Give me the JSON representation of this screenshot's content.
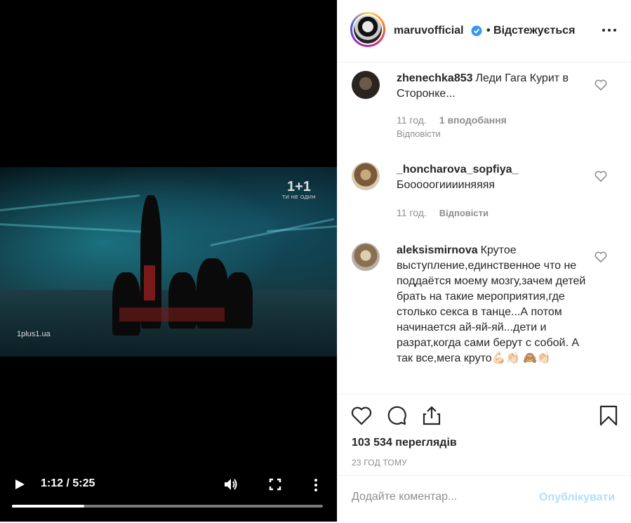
{
  "video": {
    "channel_logo": "1+1",
    "channel_tagline": "ТИ НЕ ОДИН",
    "watermark": "1plus1.ua",
    "time_display": "1:12 / 5:25",
    "progress_fraction": 0.233
  },
  "post_header": {
    "username": "maruvofficial",
    "follow_status": "• Відстежується"
  },
  "comments": [
    {
      "username": "zhenechka853",
      "text": "Леди Гага Курит в Сторонке...",
      "time": "11 год.",
      "likes": "1 вподобання",
      "reply": "Відповісти"
    },
    {
      "username": "_honcharova_sopfiya_",
      "text": "Бооооогииииняяяя",
      "time": "11 год.",
      "reply": "Відповісти"
    },
    {
      "username": "aleksismirnova",
      "text": "Крутое выступление,единственное что не поддаётся моему мозгу,зачем детей брать на такие мероприятия,где столько секса в танце...А потом начинается ай-яй-яй...дети и разрат,когда сами берут с собой. А так все,мега круто💪🏻👏🏻 🙈👏🏻"
    }
  ],
  "stats": {
    "views": "103 534 переглядів",
    "posted": "23 ГОД ТОМУ"
  },
  "compose": {
    "placeholder": "Додайте коментар...",
    "publish_label": "Опублікувати"
  },
  "colors": {
    "accent": "#3897f0",
    "publish_disabled": "#b2dffc",
    "muted": "#8e8e8e"
  }
}
